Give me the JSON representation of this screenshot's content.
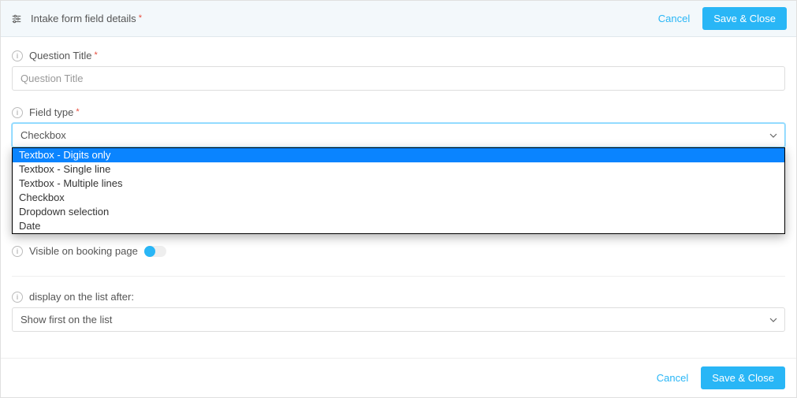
{
  "header": {
    "title": "Intake form field details",
    "cancel_label": "Cancel",
    "save_label": "Save & Close"
  },
  "question_title": {
    "label": "Question Title",
    "placeholder": "Question Title",
    "value": ""
  },
  "field_type": {
    "label": "Field type",
    "selected": "Checkbox",
    "options": [
      "Textbox - Digits only",
      "Textbox - Single line",
      "Textbox - Multiple lines",
      "Checkbox",
      "Dropdown selection",
      "Date"
    ],
    "highlighted_index": 0
  },
  "visible_booking": {
    "label": "Visible on booking page"
  },
  "display_after": {
    "label": "display on the list after:",
    "selected": "Show first on the list"
  },
  "footer": {
    "cancel_label": "Cancel",
    "save_label": "Save & Close"
  }
}
